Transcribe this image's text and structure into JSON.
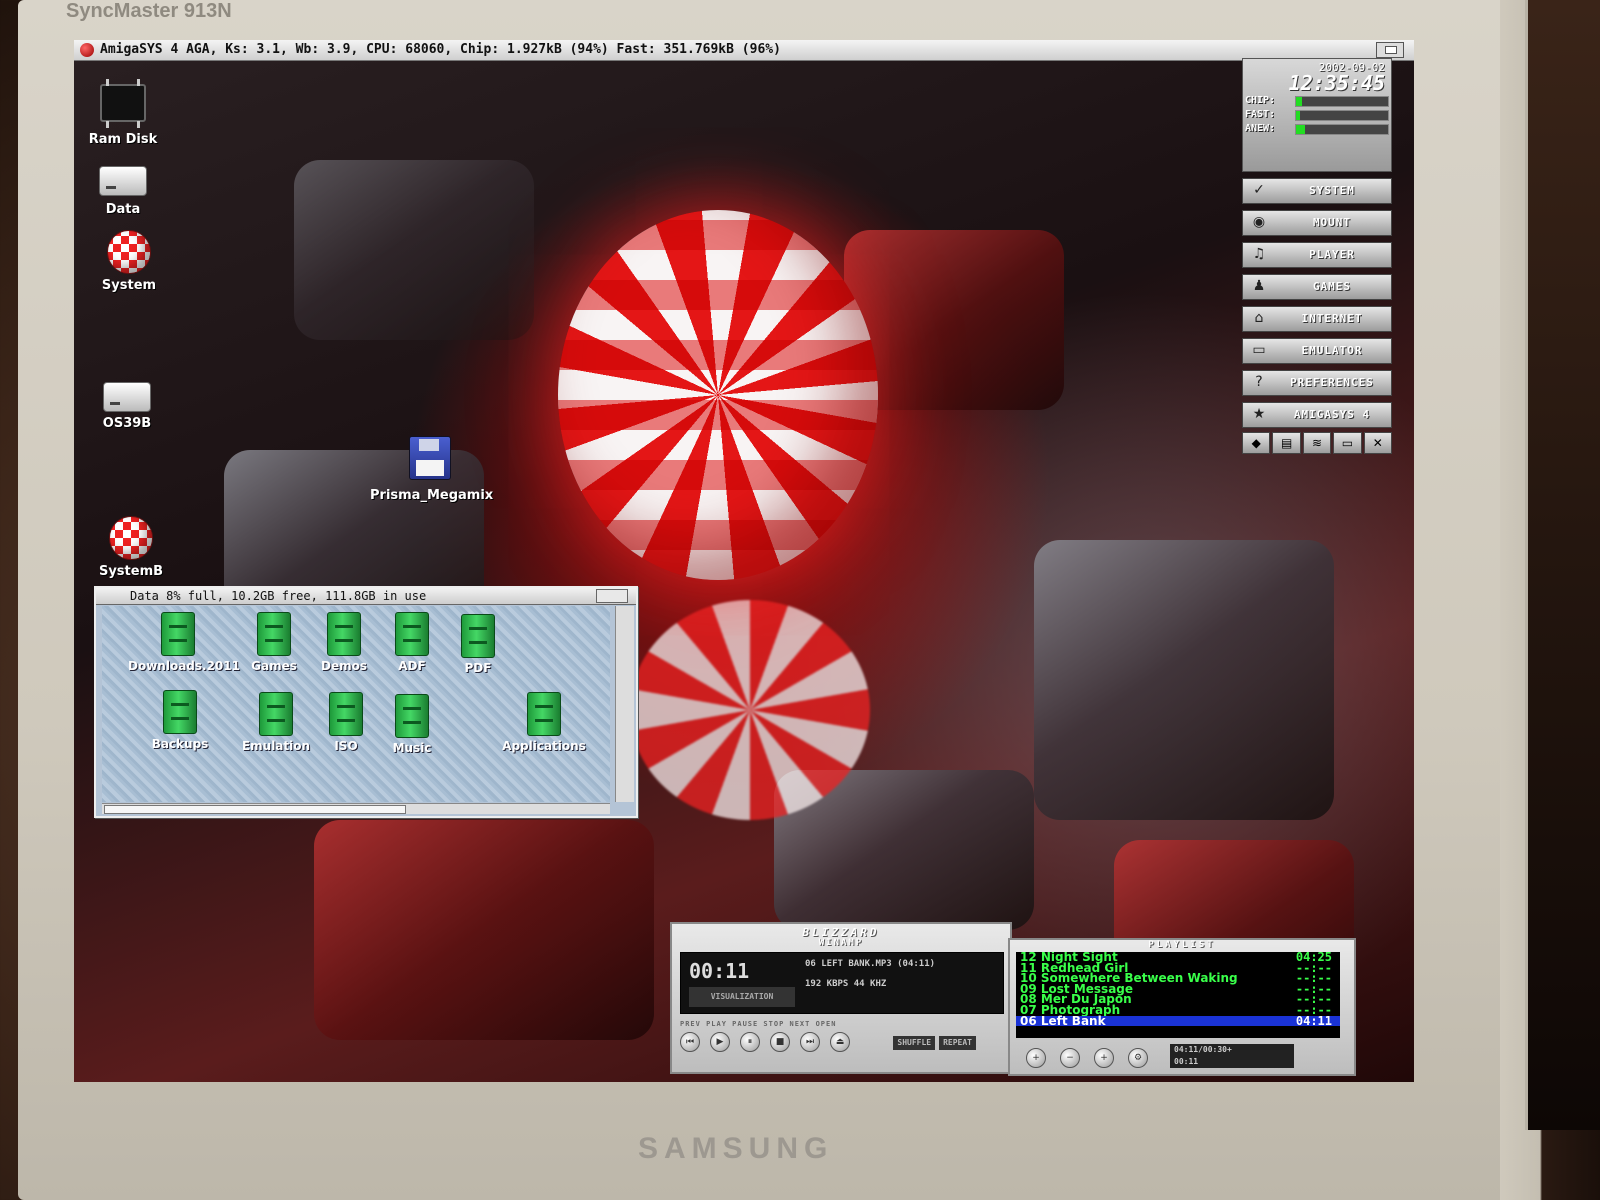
{
  "monitor": {
    "model": "SyncMaster 913N",
    "brand": "SAMSUNG"
  },
  "screen_title": "AmigaSYS 4 AGA, Ks: 3.1, Wb: 3.9, CPU: 68060, Chip: 1.927kB (94%) Fast: 351.769kB (96%)",
  "desktop_icons": [
    {
      "label": "Ram Disk",
      "icon": "ram-chip-icon"
    },
    {
      "label": "Data",
      "icon": "hard-drive-icon"
    },
    {
      "label": "System",
      "icon": "boing-ball-icon"
    },
    {
      "label": "OS39B",
      "icon": "hard-drive-icon"
    },
    {
      "label": "Prisma_Megamix",
      "icon": "floppy-disk-icon"
    },
    {
      "label": "SystemB",
      "icon": "boing-ball-icon"
    }
  ],
  "data_window": {
    "title": "Data  8% full, 10.2GB free, 111.8GB in use",
    "drawers": [
      {
        "label": "Downloads.2011"
      },
      {
        "label": "Games"
      },
      {
        "label": "Demos"
      },
      {
        "label": "ADF"
      },
      {
        "label": "PDF"
      },
      {
        "label": "Backups"
      },
      {
        "label": "Emulation"
      },
      {
        "label": "ISO"
      },
      {
        "label": "Music"
      },
      {
        "label": "Applications"
      }
    ]
  },
  "panel": {
    "date": "2002-09-02",
    "time": "12:35:45",
    "meters": [
      {
        "label": "CHIP:",
        "value": 0.06
      },
      {
        "label": "FAST:",
        "value": 0.04
      },
      {
        "label": "ANEW:",
        "value": 0.1
      }
    ],
    "buttons": [
      {
        "label": "SYSTEM",
        "icon": "check-icon"
      },
      {
        "label": "MOUNT",
        "icon": "disk-mount-icon"
      },
      {
        "label": "PLAYER",
        "icon": "music-note-icon"
      },
      {
        "label": "GAMES",
        "icon": "joystick-icon"
      },
      {
        "label": "INTERNET",
        "icon": "globe-icon"
      },
      {
        "label": "EMULATOR",
        "icon": "monitor-icon"
      },
      {
        "label": "PREFERENCES",
        "icon": "question-icon"
      },
      {
        "label": "AMIGASYS 4",
        "icon": "amigasys-logo-icon"
      }
    ],
    "mini_buttons": [
      "shortcut-1-icon",
      "shortcut-2-icon",
      "shortcut-3-icon",
      "shortcut-4-icon",
      "shortcut-5-icon"
    ]
  },
  "winamp": {
    "title": "BLIZZARD",
    "subtitle": "WINAMP",
    "time": "00:11",
    "song": "06 LEFT BANK.MP3 (04:11)",
    "kbps": "192 KBPS  44 KHZ",
    "visualization": "VISUALIZATION",
    "control_labels": "PREV  PLAY  PAUSE  STOP  NEXT   OPEN",
    "shuffle": "SHUFFLE",
    "repeat": "REPEAT"
  },
  "playlist": {
    "title": "PLAYLIST",
    "items": [
      {
        "title": "12 Night Sight",
        "duration": "04:25"
      },
      {
        "title": "11 Redhead Girl",
        "duration": "--:--"
      },
      {
        "title": "10 Somewhere Between Waking",
        "duration": "--:--"
      },
      {
        "title": "09 Lost Message",
        "duration": "--:--"
      },
      {
        "title": "08 Mer Du Japon",
        "duration": "--:--"
      },
      {
        "title": "07 Photograph",
        "duration": "--:--"
      },
      {
        "title": "06 Left Bank",
        "duration": "04:11",
        "selected": true
      }
    ],
    "button_labels": "ADD  REM  SEL  MISC",
    "time_display": "04:11/00:30+",
    "time_display_2": "00:11"
  }
}
